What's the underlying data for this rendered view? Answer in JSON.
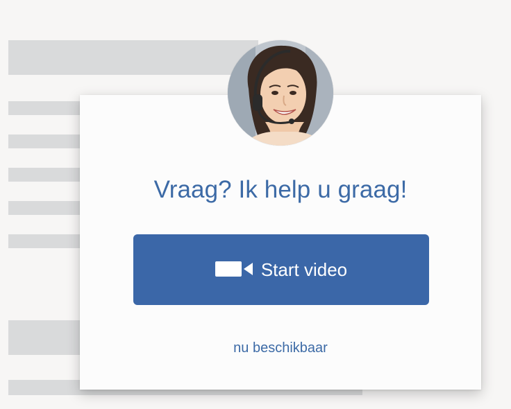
{
  "widget": {
    "heading": "Vraag? Ik help u graag!",
    "button_label": "Start video",
    "button_icon": "video-camera-icon",
    "availability": "nu beschikbaar",
    "accent_color": "#3b67a8",
    "text_color": "#3c6aa6"
  },
  "avatar": {
    "icon": "support-agent-avatar"
  }
}
